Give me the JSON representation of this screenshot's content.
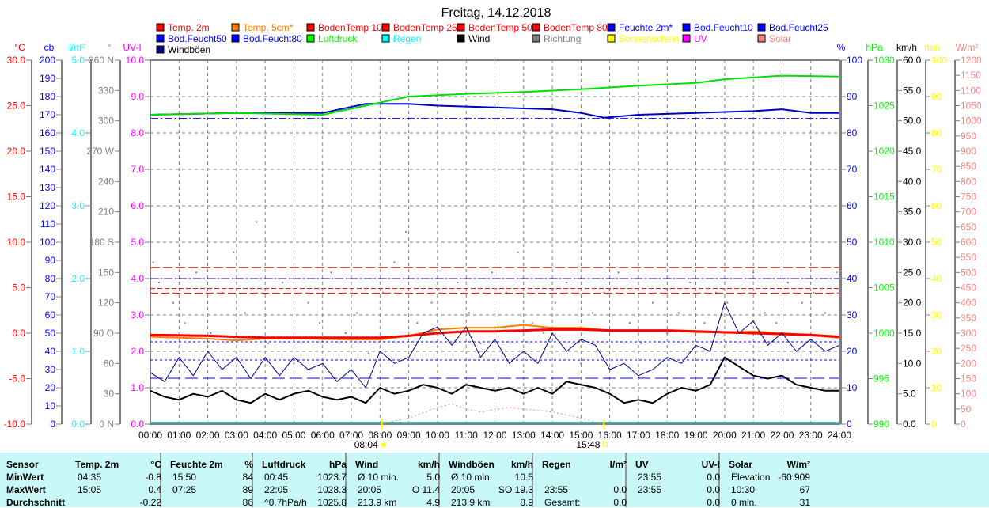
{
  "chart_data": {
    "type": "line",
    "title": "Freitag, 14.12.2018",
    "x_range_hours": [
      0,
      24
    ],
    "x_ticks": [
      "00:00",
      "01:00",
      "02:00",
      "03:00",
      "04:00",
      "05:00",
      "06:00",
      "07:00",
      "08:00",
      "09:00",
      "10:00",
      "11:00",
      "12:00",
      "13:00",
      "14:00",
      "15:00",
      "16:00",
      "17:00",
      "18:00",
      "19:00",
      "20:00",
      "21:00",
      "22:00",
      "23:00",
      "24:00"
    ],
    "sunrise": "08:04",
    "sunset": "15:48",
    "left_axes": [
      {
        "title": "°C",
        "min": -10,
        "max": 30,
        "step": 5,
        "decimals": 1,
        "color": "#ff0000"
      },
      {
        "title": "cb",
        "min": 0,
        "max": 200,
        "step": 10,
        "decimals": 0,
        "color": "#0000ff"
      },
      {
        "title": "l/m²",
        "min": 0,
        "max": 5,
        "step": 1,
        "decimals": 1,
        "color": "#00ffff"
      },
      {
        "title": "°",
        "min": 0,
        "max": 360,
        "step": 30,
        "decimals": 0,
        "color": "#808080",
        "named": {
          "0": "0 N",
          "90": "90 O",
          "180": "180 S",
          "270": "270 W",
          "360": "360 N"
        }
      },
      {
        "title": "UV-I",
        "min": 0,
        "max": 10,
        "step": 1,
        "decimals": 1,
        "color": "#ff00ff"
      }
    ],
    "right_axes": [
      {
        "title": "%",
        "min": 0,
        "max": 100,
        "step": 10,
        "decimals": 0,
        "color": "#0000ff"
      },
      {
        "title": "hPa",
        "min": 990,
        "max": 1030,
        "step": 5,
        "decimals": 0,
        "color": "#00ff00"
      },
      {
        "title": "km/h",
        "min": 0,
        "max": 60,
        "step": 5,
        "decimals": 1,
        "color": "#000000"
      },
      {
        "title": "min",
        "min": 0,
        "max": 100,
        "step": 10,
        "decimals": 0,
        "color": "#ffff00"
      },
      {
        "title": "W/m²",
        "min": 0,
        "max": 1200,
        "step": 50,
        "decimals": 0,
        "color": "#ff8080"
      }
    ],
    "legend": [
      {
        "label": "Temp. 2m",
        "color": "#ff0000"
      },
      {
        "label": "Temp. 5cm*",
        "color": "#ff8000"
      },
      {
        "label": "BodenTemp 10",
        "color": "#ff0000"
      },
      {
        "label": "BodenTemp 25",
        "color": "#ff0000"
      },
      {
        "label": "BodenTemp 50",
        "color": "#ff0000"
      },
      {
        "label": "BodenTemp 80",
        "color": "#ff0000"
      },
      {
        "label": "Feuchte 2m*",
        "color": "#0000ff"
      },
      {
        "label": "Bod.Feucht10",
        "color": "#0000ff"
      },
      {
        "label": "Bod.Feucht25",
        "color": "#0000ff"
      },
      {
        "label": "Bod.Feucht50",
        "color": "#0000ff"
      },
      {
        "label": "Bod.Feucht80",
        "color": "#0000ff"
      },
      {
        "label": "Luftdruck",
        "color": "#00ff00"
      },
      {
        "label": "Regen",
        "color": "#00ffff"
      },
      {
        "label": "Wind",
        "color": "#000000"
      },
      {
        "label": "Richtung",
        "color": "#808080"
      },
      {
        "label": "Sonnenschein",
        "color": "#ffff00"
      },
      {
        "label": "UV",
        "color": "#ff00ff"
      },
      {
        "label": "Solar",
        "color": "#ff8080"
      },
      {
        "label": "Windböen",
        "color": "#000080"
      }
    ],
    "series": [
      {
        "name": "Temp. 5cm*",
        "axis": "°C",
        "color": "#ff8000",
        "width": 2,
        "x": [
          0,
          2,
          3,
          4,
          5,
          7,
          8,
          9,
          10,
          11,
          12,
          13,
          14,
          15,
          16,
          18,
          19,
          20,
          21,
          22,
          24
        ],
        "y": [
          -0.4,
          -0.6,
          -0.8,
          -0.6,
          -0.6,
          -0.7,
          -0.7,
          -0.3,
          0.4,
          0.6,
          0.6,
          0.9,
          0.6,
          0.6,
          0.3,
          0.3,
          0.1,
          0.1,
          0.2,
          0.0,
          -0.5
        ]
      },
      {
        "name": "Temp. 2m",
        "axis": "°C",
        "color": "#ff0000",
        "width": 3,
        "x": [
          0,
          2,
          3,
          4,
          5,
          7,
          8,
          9,
          10,
          11,
          12,
          13,
          14,
          15,
          16,
          18,
          19,
          20,
          21,
          22,
          23,
          24
        ],
        "y": [
          -0.2,
          -0.3,
          -0.4,
          -0.5,
          -0.5,
          -0.5,
          -0.5,
          -0.3,
          0.0,
          0.2,
          0.2,
          0.3,
          0.4,
          0.4,
          0.3,
          0.3,
          0.2,
          0.1,
          0.0,
          -0.1,
          -0.2,
          -0.4
        ]
      },
      {
        "name": "Feuchte 2m*",
        "axis": "%",
        "color": "#0000c0",
        "width": 2,
        "x": [
          0,
          3,
          6,
          7.5,
          9,
          10,
          12,
          14,
          15,
          15.8,
          17,
          19,
          21,
          22,
          23,
          24
        ],
        "y": [
          85,
          85.5,
          85.5,
          88,
          88,
          87.5,
          87,
          86.5,
          85.5,
          84.2,
          85,
          85.5,
          86,
          86.5,
          85.5,
          85.5
        ]
      },
      {
        "name": "Luftdruck",
        "axis": "hPa",
        "color": "#00e000",
        "width": 2,
        "x": [
          0,
          3,
          6,
          7.5,
          9,
          11,
          13,
          15,
          17,
          19,
          20,
          22,
          24
        ],
        "y": [
          1024.0,
          1024.2,
          1024.0,
          1025.0,
          1026.0,
          1026.3,
          1026.5,
          1026.8,
          1027.2,
          1027.5,
          1027.9,
          1028.3,
          1028.2
        ]
      },
      {
        "name": "Solar",
        "axis": "W/m²",
        "color": "#ff8080",
        "width": 1,
        "dash": "2,3",
        "x": [
          8,
          9,
          10,
          10.5,
          11,
          11.5,
          12,
          12.5,
          13,
          14,
          15,
          15.8
        ],
        "y": [
          0,
          20,
          55,
          67,
          50,
          40,
          48,
          55,
          50,
          40,
          20,
          0
        ]
      },
      {
        "name": "Windböen",
        "axis": "km/h",
        "color": "#000080",
        "width": 1,
        "x": [
          0,
          0.5,
          1,
          1.5,
          2,
          2.5,
          3,
          3.5,
          4,
          4.5,
          5,
          5.5,
          6,
          6.5,
          7,
          7.5,
          8,
          8.5,
          9,
          9.5,
          10,
          10.5,
          11,
          11.5,
          12,
          12.5,
          13,
          13.5,
          14,
          14.5,
          15,
          15.5,
          16,
          16.5,
          17,
          17.5,
          18,
          18.5,
          19,
          19.5,
          20,
          20.5,
          21,
          21.5,
          22,
          22.5,
          23,
          23.5,
          24
        ],
        "y": [
          8.5,
          7,
          11,
          8,
          12,
          9,
          11,
          7.5,
          11,
          8,
          11,
          9,
          10,
          7,
          9,
          6,
          12,
          10,
          11,
          15,
          16,
          13,
          16,
          11,
          14,
          10,
          12,
          10,
          15,
          12,
          14,
          13,
          9,
          10,
          8,
          9,
          11,
          10,
          13,
          12,
          20,
          15,
          17,
          13,
          15,
          12,
          14,
          12,
          13
        ]
      },
      {
        "name": "Wind",
        "axis": "km/h",
        "color": "#000000",
        "width": 2,
        "x": [
          0,
          0.5,
          1,
          1.5,
          2,
          2.5,
          3,
          3.5,
          4,
          4.5,
          5,
          5.5,
          6,
          6.5,
          7,
          7.5,
          8,
          8.5,
          9,
          9.5,
          10,
          10.5,
          11,
          11.5,
          12,
          12.5,
          13,
          13.5,
          14,
          14.5,
          15,
          15.5,
          16,
          16.5,
          17,
          17.5,
          18,
          18.5,
          19,
          19.5,
          20,
          20.5,
          21,
          21.5,
          22,
          22.5,
          23,
          23.5,
          24
        ],
        "y": [
          5.5,
          4.5,
          4,
          5,
          4.5,
          5.5,
          4,
          3.5,
          5,
          4,
          5,
          5.5,
          4.5,
          4,
          4.5,
          3.5,
          6,
          5,
          5.5,
          6.5,
          6,
          5,
          6.5,
          6,
          5.5,
          6,
          5,
          6,
          5,
          7,
          6.5,
          6,
          5,
          3.5,
          4,
          3.5,
          5,
          6,
          5.5,
          6.5,
          11,
          9.5,
          8,
          7.5,
          8,
          6.5,
          6,
          5.5,
          5.5
        ]
      }
    ],
    "constant_lines": [
      {
        "name": "BodenTemp 10",
        "axis": "°C",
        "value": 4.4,
        "color": "#ff0000",
        "dash": "10,4"
      },
      {
        "name": "BodenTemp 25",
        "axis": "°C",
        "value": 4.9,
        "color": "#ff0000",
        "dash": "6,3"
      },
      {
        "name": "BodenTemp 50",
        "axis": "°C",
        "value": 6.0,
        "color": "#ff0000",
        "dash": "10,3,2,3"
      },
      {
        "name": "BodenTemp 80",
        "axis": "°C",
        "value": 7.2,
        "color": "#ff0000",
        "dash": "12,4"
      },
      {
        "name": "Bod.Feucht10",
        "axis": "%",
        "value": 40,
        "color": "#0000c0",
        "dash": "10,3,2,3"
      },
      {
        "name": "Bod.Feucht25",
        "axis": "%",
        "value": 22.6,
        "color": "#0000ff",
        "dash": "3,3"
      },
      {
        "name": "Bod.Feucht50",
        "axis": "%",
        "value": 17.6,
        "color": "#0000ff",
        "dash": "3,3"
      },
      {
        "name": "Bod.Feucht80",
        "axis": "%",
        "value": 12.6,
        "color": "#0000ff",
        "dash": "16,6"
      },
      {
        "name": "Bod.Feucht",
        "axis": "%",
        "value": 84,
        "color": "#0000ff",
        "dash": "10,3,2,3"
      }
    ],
    "direction": {
      "axis": "°",
      "color": "#808080",
      "x": [
        0.1,
        0.3,
        0.8,
        1.2,
        1.6,
        2.1,
        2.5,
        2.9,
        3.3,
        3.7,
        4.1,
        4.6,
        5.0,
        5.5,
        5.9,
        6.3,
        6.8,
        7.2,
        7.6,
        8.1,
        8.5,
        8.9,
        9.3,
        9.8,
        10.2,
        10.7,
        11.1,
        11.5,
        11.9,
        12.4,
        12.8,
        13.3,
        13.7,
        14.1,
        14.5,
        15.0,
        15.4,
        15.8,
        16.3,
        16.7,
        17.1,
        17.5,
        18.0,
        18.4,
        18.8,
        19.3,
        19.7,
        20.1,
        20.5,
        21.0,
        21.4,
        21.8,
        22.2,
        22.7,
        23.1,
        23.5,
        23.9
      ],
      "y": [
        160,
        140,
        120,
        100,
        150,
        90,
        130,
        170,
        110,
        200,
        80,
        140,
        60,
        120,
        100,
        150,
        90,
        110,
        70,
        130,
        160,
        190,
        100,
        120,
        90,
        140,
        110,
        80,
        150,
        130,
        170,
        100,
        90,
        120,
        140,
        60,
        110,
        130,
        150,
        100,
        80,
        120,
        90,
        110,
        140,
        100,
        130,
        120,
        90,
        150,
        110,
        100,
        140,
        120,
        130,
        110,
        150
      ]
    }
  },
  "stats": {
    "headers": {
      "sensor": "Sensor",
      "temp": "Temp. 2m",
      "temp_unit": "°C",
      "hum": "Feuchte 2m",
      "hum_unit": "%",
      "press": "Luftdruck",
      "press_unit": "hPa",
      "wind": "Wind",
      "wind_unit": "km/h",
      "gust": "Windböen",
      "gust_unit": "km/h",
      "rain": "Regen",
      "rain_unit": "l/m²",
      "uv": "UV",
      "uv_unit": "UV-I",
      "solar": "Solar",
      "solar_unit": "W/m²"
    },
    "rows": [
      {
        "label": "MinWert",
        "temp_t": "04:35",
        "temp_v": "-0.8",
        "hum_t": "15:50",
        "hum_v": "84",
        "press_t": "00:45",
        "press_v": "1023.7",
        "wind_t": "Ø 10 min.",
        "wind_v": "5.0",
        "gust_t": "Ø 10 min.",
        "gust_v": "10.5",
        "rain_t": "",
        "rain_v": "",
        "uv_t": "23:55",
        "uv_v": "0.0",
        "solar_t": "Elevation",
        "solar_v": "-60.909"
      },
      {
        "label": "MaxWert",
        "temp_t": "15:05",
        "temp_v": "0.4",
        "hum_t": "07:25",
        "hum_v": "89",
        "press_t": "22:05",
        "press_v": "1028.3",
        "wind_t": "20:05",
        "wind_v": "O 11.4",
        "gust_t": "20:05",
        "gust_v": "SO 19.3",
        "rain_t": "23:55",
        "rain_v": "0.0",
        "uv_t": "23:55",
        "uv_v": "0.0",
        "solar_t": "10:30",
        "solar_v": "67"
      },
      {
        "label": "Durchschnitt",
        "temp_t": "",
        "temp_v": "-0.22",
        "hum_t": "",
        "hum_v": "86",
        "press_t": "^0.7hPa/h",
        "press_v": "1025.8",
        "wind_t": "213.9 km",
        "wind_v": "4.9",
        "gust_t": "213.9 km",
        "gust_v": "8.9",
        "rain_t": "Gesamt:",
        "rain_v": "0.0",
        "uv_t": "",
        "uv_v": "0.0",
        "solar_t": "0 min.",
        "solar_v": "31"
      }
    ]
  }
}
